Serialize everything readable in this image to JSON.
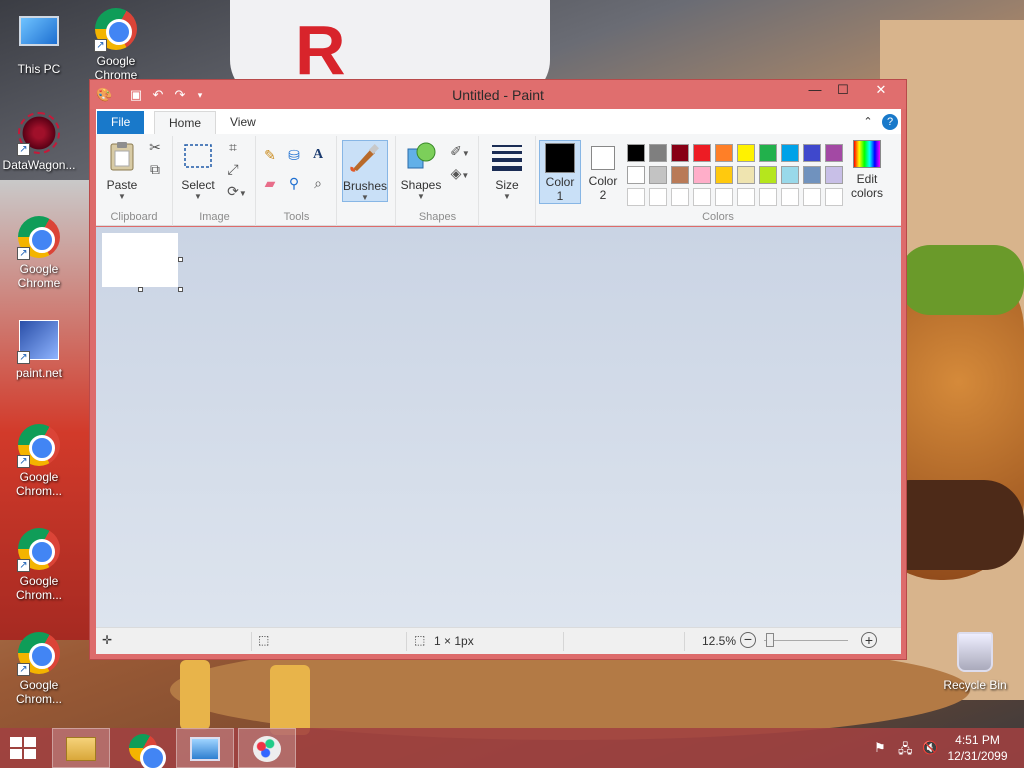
{
  "desktop": {
    "icons": [
      {
        "label": "This PC"
      },
      {
        "label": "Google Chrome"
      },
      {
        "label": "DataWagon..."
      },
      {
        "label": "Google Chrome"
      },
      {
        "label": "paint.net"
      },
      {
        "label": "Google Chrom..."
      },
      {
        "label": "Google Chrom..."
      },
      {
        "label": "Google Chrom..."
      },
      {
        "label": "Recycle Bin"
      }
    ]
  },
  "window": {
    "title": "Untitled - Paint",
    "tabs": [
      "File",
      "Home",
      "View"
    ],
    "ribbon": {
      "clipboard": {
        "paste": "Paste",
        "group": "Clipboard"
      },
      "image": {
        "select": "Select",
        "group": "Image"
      },
      "tools": {
        "text_icon": "A",
        "group": "Tools"
      },
      "brushes": {
        "label": "Brushes"
      },
      "shapes": {
        "label": "Shapes",
        "group": "Shapes"
      },
      "size": {
        "label": "Size"
      },
      "colors": {
        "color1_line1": "Color",
        "color1_line2": "1",
        "color2_line1": "Color",
        "color2_line2": "2",
        "edit_line1": "Edit",
        "edit_line2": "colors",
        "group": "Colors",
        "color1_value": "#000000",
        "color2_value": "#ffffff",
        "palette_row1": [
          "#000000",
          "#7f7f7f",
          "#880015",
          "#ed1c24",
          "#ff7f27",
          "#fff200",
          "#22b14c",
          "#00a2e8",
          "#3f48cc",
          "#a349a4"
        ],
        "palette_row2": [
          "#ffffff",
          "#c3c3c3",
          "#b97a57",
          "#ffaec9",
          "#ffc90e",
          "#efe4b0",
          "#b5e61d",
          "#99d9ea",
          "#7092be",
          "#c8bfe7"
        ]
      }
    },
    "status": {
      "image_size": "1 × 1px",
      "zoom": "12.5%"
    }
  },
  "taskbar": {
    "clock_time": "4:51 PM",
    "clock_date": "12/31/2099"
  }
}
